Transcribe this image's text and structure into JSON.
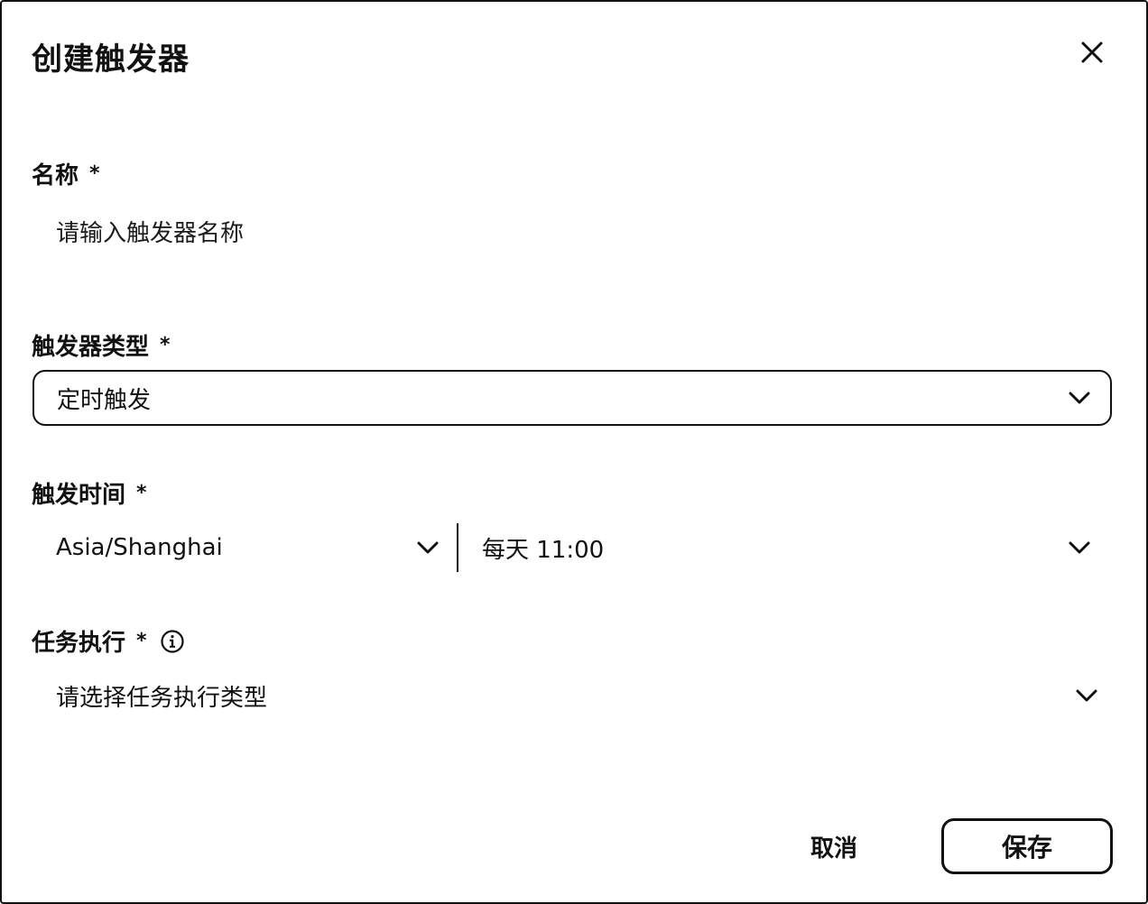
{
  "dialog": {
    "title": "创建触发器",
    "close_icon": "close-icon"
  },
  "fields": {
    "name": {
      "label": "名称",
      "required_mark": "*",
      "placeholder": "请输入触发器名称"
    },
    "trigger_type": {
      "label": "触发器类型",
      "required_mark": "*",
      "selected": "定时触发",
      "icon": "chevron-down-icon"
    },
    "trigger_time": {
      "label": "触发时间",
      "required_mark": "*",
      "timezone": "Asia/Shanghai",
      "schedule": "每天 11:00",
      "icon": "chevron-down-icon"
    },
    "task_execution": {
      "label": "任务执行",
      "required_mark": "*",
      "info_icon": "info-icon",
      "placeholder": "请选择任务执行类型",
      "icon": "chevron-down-icon"
    }
  },
  "footer": {
    "cancel_label": "取消",
    "save_label": "保存"
  }
}
